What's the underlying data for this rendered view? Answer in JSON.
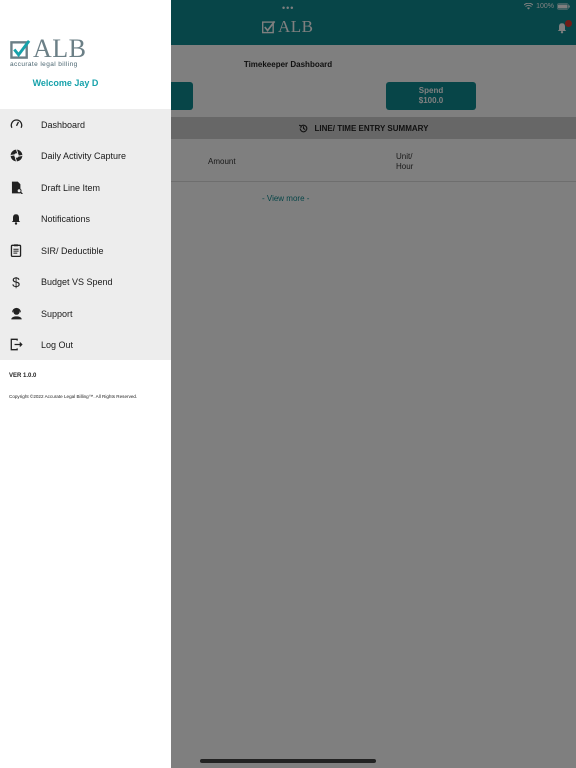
{
  "status_bar": {
    "dots": "•••",
    "battery": "100%"
  },
  "app": {
    "logo_text": "ALB",
    "dashboard_title": "Timekeeper Dashboard",
    "spend_button": {
      "label": "Spend",
      "value": "$100.0"
    },
    "summary_label": "LINE/ TIME ENTRY SUMMARY",
    "columns": {
      "amount": "Amount",
      "unit_hour": "Unit/\nHour"
    },
    "view_more": "- View more -"
  },
  "drawer": {
    "logo": {
      "text": "ALB",
      "tagline": "accurate legal billing"
    },
    "welcome": "Welcome Jay D",
    "menu": [
      {
        "label": "Dashboard",
        "icon": "speedometer-icon"
      },
      {
        "label": "Daily Activity Capture",
        "icon": "camera-shutter-icon"
      },
      {
        "label": "Draft Line Item",
        "icon": "draft-document-icon"
      },
      {
        "label": "Notifications",
        "icon": "bell-icon"
      },
      {
        "label": "SIR/ Deductible",
        "icon": "clipboard-icon"
      },
      {
        "label": "Budget VS Spend",
        "icon": "dollar-icon"
      },
      {
        "label": "Support",
        "icon": "support-agent-icon"
      },
      {
        "label": "Log Out",
        "icon": "logout-icon"
      }
    ],
    "version": "VER 1.0.0",
    "copyright": "Copyright ©2022 Accurate Legal Billing™. All Rights Reserved."
  },
  "colors": {
    "brand": "#0e8b91",
    "welcome": "#17a2ab",
    "menu_bg": "#ededed",
    "badge": "#e0392f"
  }
}
